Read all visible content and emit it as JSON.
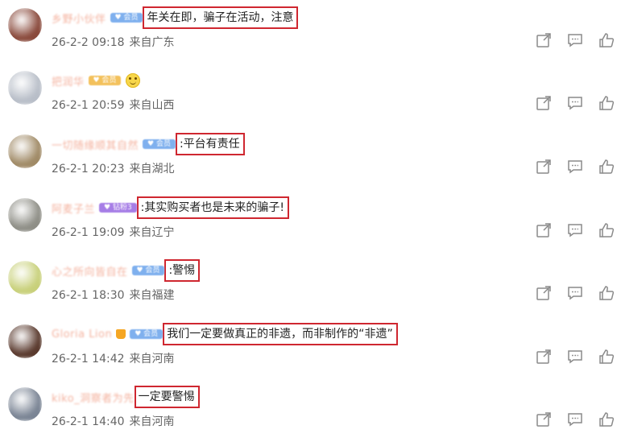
{
  "comments": [
    {
      "username": "乡野小伙伴",
      "badge": "♥ 会员",
      "badge_kind": "vip",
      "text": "年关在即，骗子在活动，注意",
      "date": "26-2-2 09:18",
      "location": "来自广东",
      "avatar_color": "#8a4a3c"
    },
    {
      "username": "把润华",
      "badge": "♥ 会员",
      "badge_kind": "gold",
      "emoji_icon": "smiley-emoji-icon",
      "text": "",
      "date": "26-2-1 20:59",
      "location": "来自山西",
      "avatar_color": "#b8bec8"
    },
    {
      "username": "一切随缘顺其自然",
      "badge": "♥ 会员",
      "badge_kind": "vip",
      "text": ":平台有责任",
      "date": "26-2-1 20:23",
      "location": "来自湖北",
      "avatar_color": "#a08a66"
    },
    {
      "username": "阿麦子兰",
      "badge": "♥ 钻粉3",
      "badge_kind": "purple",
      "text": ":其实购买者也是未来的骗子!",
      "date": "26-2-1 19:09",
      "location": "来自辽宁",
      "avatar_color": "#8e8e86"
    },
    {
      "username": "心之所向皆自在",
      "badge": "♥ 会员",
      "badge_kind": "vip",
      "text": ":警惕",
      "date": "26-2-1 18:30",
      "location": "来自福建",
      "avatar_color": "#c8d07a"
    },
    {
      "username": "Gloria Lion",
      "badge": "♥ 会员",
      "badge_kind": "vip",
      "crown": true,
      "text": "我们一定要做真正的非遗，而非制作的“非遗”",
      "date": "26-2-1 14:42",
      "location": "来自河南",
      "avatar_color": "#5a3a2e"
    },
    {
      "username": "kiko_洞察者为先",
      "badge": "",
      "badge_kind": "none",
      "text": "一定要警惕",
      "date": "26-2-1 14:40",
      "location": "来自河南",
      "avatar_color": "#7a8494"
    }
  ],
  "icons": {
    "share": "share-icon",
    "reply": "comment-icon",
    "like": "thumbs-up-icon"
  },
  "colors": {
    "highlight_border": "#cf2730",
    "icon_gray": "#8a8a8a"
  }
}
